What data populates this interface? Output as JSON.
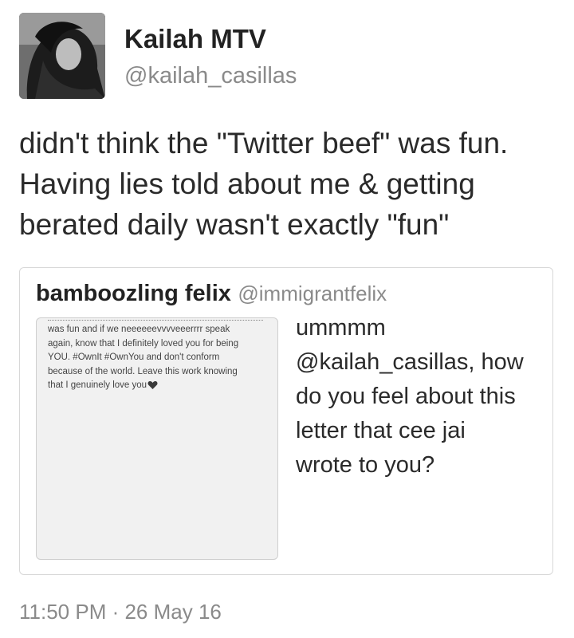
{
  "author": {
    "display_name": "Kailah MTV",
    "handle": "@kailah_casillas",
    "avatar_icon": "profile-photo"
  },
  "tweet": {
    "lines": [
      "didn't think the \"Twitter beef\" was fun.",
      "Having lies told about me & getting",
      "berated daily wasn't exactly \"fun\""
    ]
  },
  "quoted_tweet": {
    "display_name": "bamboozling felix",
    "handle": "@immigrantfelix",
    "text_lines": [
      "ummmm",
      "@kailah_casillas, how",
      "do you feel about this",
      "letter that cee jai",
      "wrote to you?"
    ],
    "image": {
      "letter_lines": [
        "was fun and if we neeeeeevvvveeerrrr speak",
        "again, know that I definitely loved you for being",
        "YOU. #OwnIt #OwnYou and don't conform",
        "because of the world. Leave this work knowing",
        "that I genuinely love you"
      ],
      "end_icon": "heart-icon"
    }
  },
  "timestamp": "11:50 PM · 26 May 16",
  "colors": {
    "text": "#2a2a2a",
    "secondary": "#8a8a8a",
    "border": "#d8d8d8"
  }
}
